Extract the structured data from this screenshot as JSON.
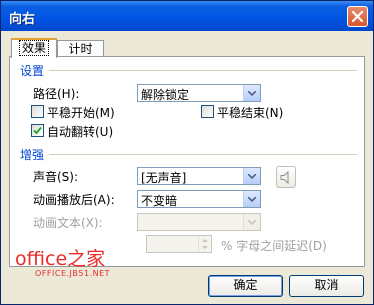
{
  "window": {
    "title": "向右"
  },
  "tabs": [
    {
      "label": "效果"
    },
    {
      "label": "计时"
    }
  ],
  "settings": {
    "heading": "设置",
    "path_label": "路径(H):",
    "path_value": "解除锁定",
    "smooth_start_label": "平稳开始(M)",
    "smooth_end_label": "平稳结束(N)",
    "auto_reverse_label": "自动翻转(U)",
    "smooth_start_checked": false,
    "smooth_end_checked": false,
    "auto_reverse_checked": true
  },
  "enhancements": {
    "heading": "增强",
    "sound_label": "声音(S):",
    "sound_value": "[无声音]",
    "after_anim_label": "动画播放后(A):",
    "after_anim_value": "不变暗",
    "anim_text_label": "动画文本(X):",
    "anim_text_value": "",
    "delay_value": "",
    "delay_suffix": "% 字母之间延迟(D)"
  },
  "buttons": {
    "ok": "确定",
    "cancel": "取消"
  },
  "watermark": {
    "main": "office之家",
    "sub": "OFFICE.JB51.NET"
  }
}
